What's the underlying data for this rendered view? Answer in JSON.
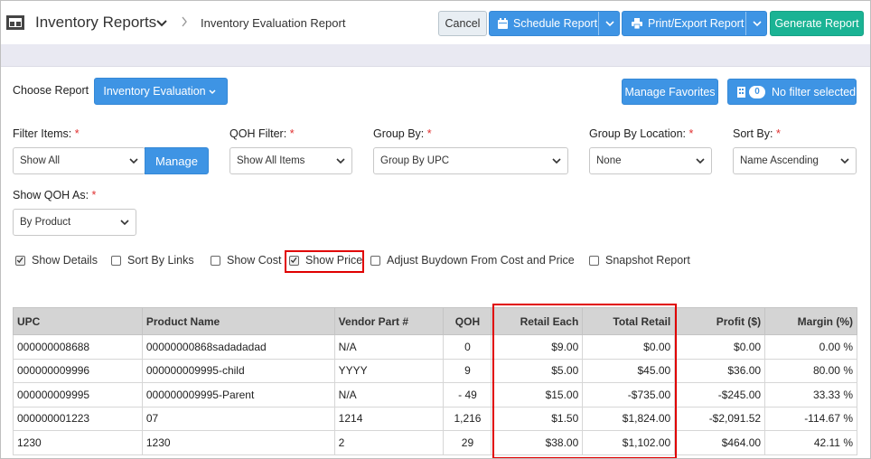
{
  "header": {
    "app_title": "Inventory Reports",
    "breadcrumb": "Inventory Evaluation Report",
    "cancel_label": "Cancel",
    "schedule_label": "Schedule Report",
    "print_label": "Print/Export Report",
    "generate_label": "Generate Report"
  },
  "choose": {
    "label": "Choose Report",
    "report_label": "Inventory Evaluation",
    "favorites_label": "Manage Favorites",
    "filter_count": "0",
    "filter_label": "No filter selected"
  },
  "filters": {
    "filter_items": {
      "label": "Filter Items:",
      "value": "Show All",
      "manage_label": "Manage"
    },
    "qoh_filter": {
      "label": "QOH Filter:",
      "value": "Show All Items"
    },
    "group_by": {
      "label": "Group By:",
      "value": "Group By UPC"
    },
    "group_by_location": {
      "label": "Group By Location:",
      "value": "None"
    },
    "sort_by": {
      "label": "Sort By:",
      "value": "Name Ascending"
    },
    "show_qoh_as": {
      "label": "Show QOH As:",
      "value": "By Product"
    },
    "required_mark": "*"
  },
  "options": [
    {
      "label": "Show Details",
      "checked": true
    },
    {
      "label": "Sort By Links",
      "checked": false
    },
    {
      "label": "Show Cost",
      "checked": false
    },
    {
      "label": "Show Price",
      "checked": true
    },
    {
      "label": "Adjust Buydown From Cost and Price",
      "checked": false
    },
    {
      "label": "Snapshot Report",
      "checked": false
    }
  ],
  "table": {
    "columns": [
      "UPC",
      "Product Name",
      "Vendor Part #",
      "QOH",
      "Retail Each",
      "Total Retail",
      "Profit ($)",
      "Margin (%)"
    ],
    "rows": [
      [
        "000000008688",
        "00000000868sadadadad",
        "N/A",
        "0",
        "$9.00",
        "$0.00",
        "$0.00",
        "0.00 %"
      ],
      [
        "000000009996",
        "000000009995-child",
        "YYYY",
        "9",
        "$5.00",
        "$45.00",
        "$36.00",
        "80.00 %"
      ],
      [
        "000000009995",
        "000000009995-Parent",
        "N/A",
        "- 49",
        "$15.00",
        "-$735.00",
        "-$245.00",
        "33.33 %"
      ],
      [
        "000000001223",
        "07",
        "1214",
        "1,216",
        "$1.50",
        "$1,824.00",
        "-$2,091.52",
        "-114.67 %"
      ],
      [
        "1230",
        "1230",
        "2",
        "29",
        "$38.00",
        "$1,102.00",
        "$464.00",
        "42.11 %"
      ]
    ]
  },
  "colors": {
    "primary": "#3e94e4",
    "success": "#1ab394",
    "negative": "#e02020",
    "highlight": "#e00000"
  }
}
